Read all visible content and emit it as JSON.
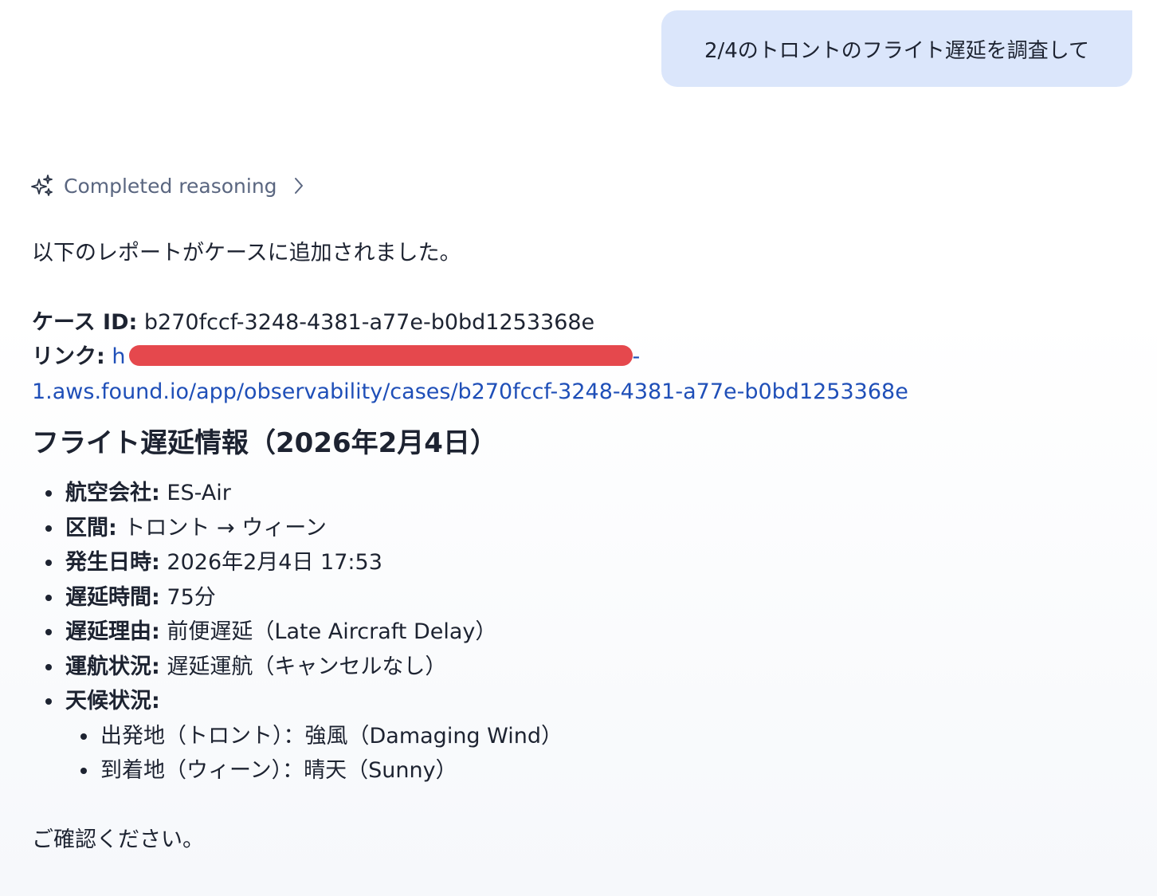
{
  "user_message": "2/4のトロントのフライト遅延を調査して",
  "reasoning": {
    "label": "Completed reasoning",
    "icon": "sparkles-icon"
  },
  "response": {
    "intro": "以下のレポートがケースに追加されました。",
    "case_id_label": "ケース ID:",
    "case_id_value": "b270fccf-3248-4381-a77e-b0bd1253368e",
    "link_label": "リンク:",
    "link_first_line_visible": "h",
    "link_first_line_tail": "-",
    "link_second_line": "1.aws.found.io/app/observability/cases/b270fccf-3248-4381-a77e-b0bd1253368e",
    "heading": "フライト遅延情報（2026年2月4日）",
    "items": [
      {
        "label": "航空会社:",
        "value": "ES-Air"
      },
      {
        "label": "区間:",
        "value": "トロント → ウィーン"
      },
      {
        "label": "発生日時:",
        "value": "2026年2月4日 17:53"
      },
      {
        "label": "遅延時間:",
        "value": "75分"
      },
      {
        "label": "遅延理由:",
        "value": "前便遅延（Late Aircraft Delay）"
      },
      {
        "label": "運航状況:",
        "value": "遅延運航（キャンセルなし）"
      },
      {
        "label": "天候状況:",
        "value": ""
      }
    ],
    "weather": [
      "出発地（トロント）：強風（Damaging Wind）",
      "到着地（ウィーン）：晴天（Sunny）"
    ],
    "closing": "ご確認ください。"
  }
}
